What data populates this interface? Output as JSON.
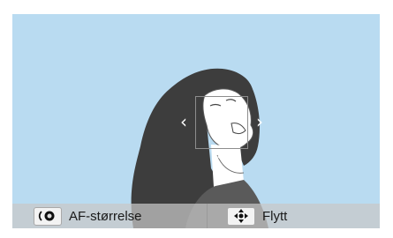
{
  "preview": {
    "scene": "woman-laughing-face-photo"
  },
  "focus": {
    "arrows": {
      "left": "‹",
      "right": "›",
      "down": "⌄"
    }
  },
  "bottom_bar": {
    "af_size": {
      "icon": "control-dial-icon",
      "label": "AF-størrelse"
    },
    "move": {
      "icon": "directional-pad-icon",
      "label": "Flytt"
    }
  }
}
